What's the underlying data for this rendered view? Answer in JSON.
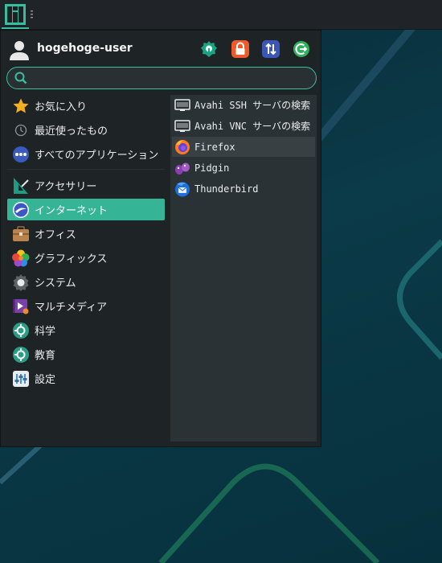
{
  "panel": {
    "launcher_icon": "manjaro-logo-icon"
  },
  "user": {
    "name": "hogehoge-user",
    "avatar_icon": "user-avatar-icon"
  },
  "actions": [
    {
      "name": "settings-manager-button",
      "icon": "settings-icon",
      "color": "#1aa383"
    },
    {
      "name": "lock-screen-button",
      "icon": "lock-icon",
      "color": "#ee5a2a"
    },
    {
      "name": "switch-user-button",
      "icon": "switch-arrows-icon",
      "color": "#3c56b8"
    },
    {
      "name": "logout-button",
      "icon": "logout-icon",
      "color": "#2fb05d"
    }
  ],
  "search": {
    "value": "",
    "placeholder": ""
  },
  "categories": [
    {
      "label": "お気に入り",
      "icon": "star-icon"
    },
    {
      "label": "最近使ったもの",
      "icon": "clock-icon"
    },
    {
      "label": "すべてのアプリケーション",
      "icon": "all-apps-icon"
    },
    {
      "label": "アクセサリー",
      "icon": "accessories-icon"
    },
    {
      "label": "インターネット",
      "icon": "internet-globe-icon"
    },
    {
      "label": "オフィス",
      "icon": "briefcase-icon"
    },
    {
      "label": "グラフィックス",
      "icon": "graphics-flower-icon"
    },
    {
      "label": "システム",
      "icon": "system-gear-icon"
    },
    {
      "label": "マルチメディア",
      "icon": "multimedia-icon"
    },
    {
      "label": "科学",
      "icon": "science-icon"
    },
    {
      "label": "教育",
      "icon": "education-icon"
    },
    {
      "label": "設定",
      "icon": "settings-sliders-icon"
    }
  ],
  "active_category": "インターネット",
  "apps": [
    {
      "label": "Avahi SSH サーバの検索",
      "icon": "network-monitor-icon"
    },
    {
      "label": "Avahi VNC サーバの検索",
      "icon": "network-monitor-icon"
    },
    {
      "label": "Firefox",
      "icon": "firefox-icon"
    },
    {
      "label": "Pidgin",
      "icon": "pidgin-icon"
    },
    {
      "label": "Thunderbird",
      "icon": "thunderbird-icon"
    }
  ],
  "colors": {
    "accent": "#35b596",
    "menu_bg": "#1e2326",
    "apps_bg": "#2b3235"
  }
}
